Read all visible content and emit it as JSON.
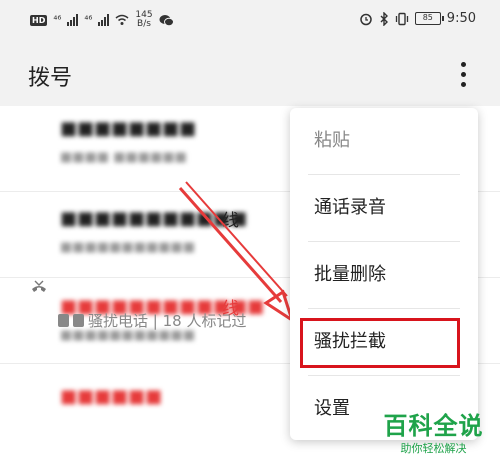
{
  "status_bar": {
    "hd_badge": "HD",
    "signal1_label": "⁴⁶",
    "signal2_label": "⁴⁶",
    "net_speed_value": "145",
    "net_speed_unit": "B/s",
    "battery_level": "85",
    "time": "9:50"
  },
  "header": {
    "title": "拨号"
  },
  "calls": [
    {
      "name": "■■■■■■■■",
      "name_color": "dark",
      "sub": "■■■■ ■■■■■■"
    },
    {
      "name": "■■■■■■■■■■■",
      "tail": "线",
      "name_color": "dark",
      "sub": "■■■■■■■■■■■"
    },
    {
      "name": "■■■■■■■■■■■■",
      "tail": "线",
      "name_color": "red",
      "sub": "■■■■■■■■■■■"
    },
    {
      "name": "■■■■■■",
      "name_color": "red",
      "detail": "骚扰电话 | 18 人标记过"
    }
  ],
  "menu": {
    "items": [
      {
        "label": "粘贴",
        "disabled": true
      },
      {
        "label": "通话录音",
        "disabled": false
      },
      {
        "label": "批量删除",
        "disabled": false
      },
      {
        "label": "骚扰拦截",
        "disabled": false,
        "highlighted": true
      },
      {
        "label": "设置",
        "disabled": false
      }
    ]
  },
  "watermark": {
    "title": "百科全说",
    "subtitle": "助你轻松解决"
  },
  "colors": {
    "accent_red": "#d8141c",
    "missed_red": "#e63b3b",
    "watermark_green": "#1fa34a"
  }
}
